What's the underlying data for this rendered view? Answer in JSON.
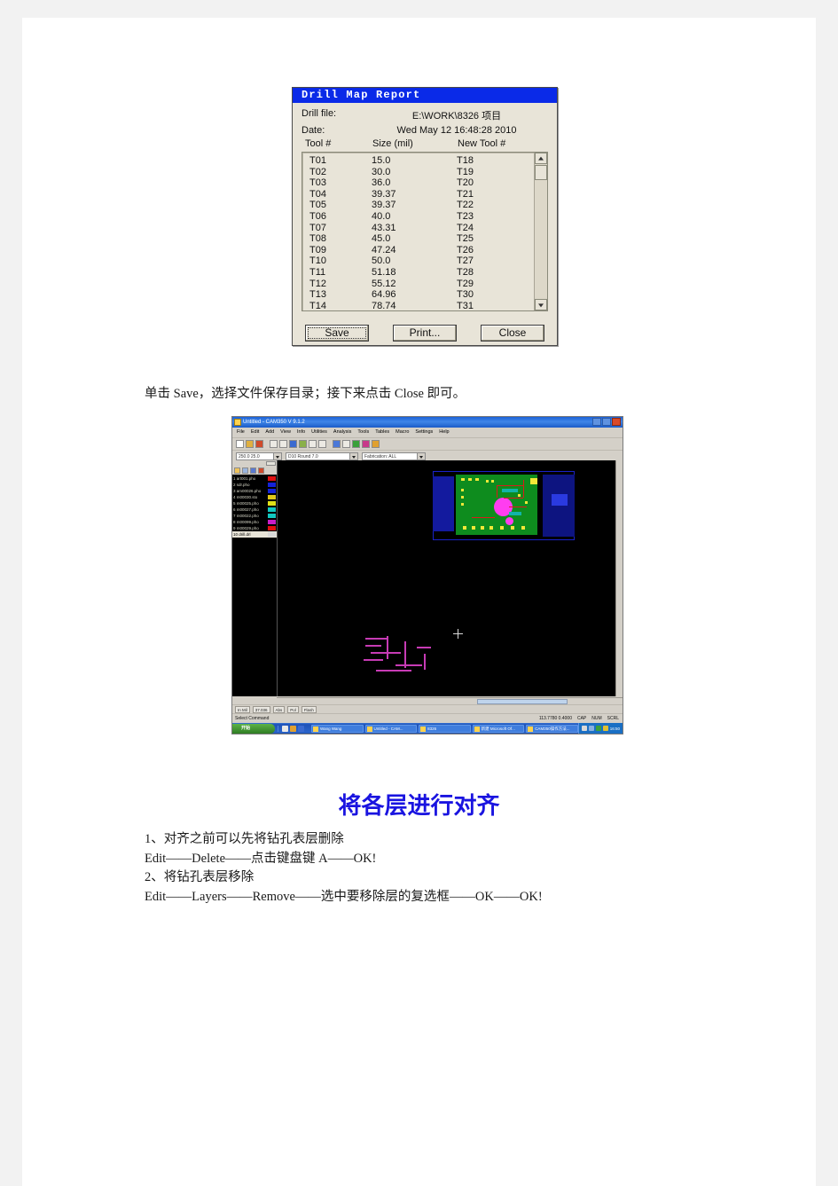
{
  "dialog": {
    "title": "Drill Map Report",
    "drill_file_label": "Drill file:",
    "drill_file_value": "E:\\WORK\\8326 项目",
    "date_label": "Date:",
    "date_value": "Wed May 12 16:48:28 2010",
    "columns": [
      "Tool #",
      "Size (mil)",
      "New Tool #"
    ],
    "rows": [
      {
        "tool": "T01",
        "size": "15.0",
        "new_tool": "T18"
      },
      {
        "tool": "T02",
        "size": "30.0",
        "new_tool": "T19"
      },
      {
        "tool": "T03",
        "size": "36.0",
        "new_tool": "T20"
      },
      {
        "tool": "T04",
        "size": "39.37",
        "new_tool": "T21"
      },
      {
        "tool": "T05",
        "size": "39.37",
        "new_tool": "T22"
      },
      {
        "tool": "T06",
        "size": "40.0",
        "new_tool": "T23"
      },
      {
        "tool": "T07",
        "size": "43.31",
        "new_tool": "T24"
      },
      {
        "tool": "T08",
        "size": "45.0",
        "new_tool": "T25"
      },
      {
        "tool": "T09",
        "size": "47.24",
        "new_tool": "T26"
      },
      {
        "tool": "T10",
        "size": "50.0",
        "new_tool": "T27"
      },
      {
        "tool": "T11",
        "size": "51.18",
        "new_tool": "T28"
      },
      {
        "tool": "T12",
        "size": "55.12",
        "new_tool": "T29"
      },
      {
        "tool": "T13",
        "size": "64.96",
        "new_tool": "T30"
      },
      {
        "tool": "T14",
        "size": "78.74",
        "new_tool": "T31"
      }
    ],
    "buttons": {
      "save": "Save",
      "print": "Print...",
      "close": "Close"
    }
  },
  "caption": "单击 Save，选择文件保存目录；接下来点击 Close 即可。",
  "cam": {
    "title": "Untitled - CAM350 V 9.1.2",
    "menus": [
      "File",
      "Edit",
      "Add",
      "View",
      "Info",
      "Utilities",
      "Analysis",
      "Tools",
      "Tables",
      "Macro",
      "Settings",
      "Help"
    ],
    "combos": {
      "units": "250.0 25.0",
      "layer": "D10  Round 7.0",
      "table": "Fabrication: ALL"
    },
    "layers": [
      {
        "name": "1 art001.pho",
        "color": "#e01010"
      },
      {
        "name": "2 sdr.pho",
        "color": "#1422d8"
      },
      {
        "name": "3 am00026.pho",
        "color": "#1422d8"
      },
      {
        "name": "4 m00030.sto",
        "color": "#e0c818"
      },
      {
        "name": "5 m00025.pho",
        "color": "#e0e018"
      },
      {
        "name": "6 m00027.pho",
        "color": "#12c8c0"
      },
      {
        "name": "7 m00022.pho",
        "color": "#12c8c0"
      },
      {
        "name": "8 m00099.pho",
        "color": "#c81ec8"
      },
      {
        "name": "9 m00029.pho",
        "color": "#e01010"
      },
      {
        "name": "10 drill.drl",
        "color": "#d8d8d8",
        "selected": true
      }
    ],
    "status_cells": [
      "In  Mil",
      "37.036",
      "Abs",
      "Pol",
      "Flash"
    ],
    "command_prompt": "Select Command",
    "coordinates": "113.7780 0.4000",
    "status_right": [
      "CAP",
      "NUM",
      "SCRL"
    ],
    "taskbar": {
      "start": "开始",
      "items": [
        "Wang Wang",
        "Untitled - CAM...",
        "8326",
        "新建 Microsoft Of...",
        "CAM350操作方法..."
      ],
      "clock": "16:50"
    }
  },
  "section_heading": "将各层进行对齐",
  "steps": [
    "1、对齐之前可以先将钻孔表层删除",
    "Edit——Delete——点击键盘键 A——OK!",
    "2、将钻孔表层移除",
    "Edit——Layers——Remove——选中要移除层的复选框——OK——OK!"
  ]
}
